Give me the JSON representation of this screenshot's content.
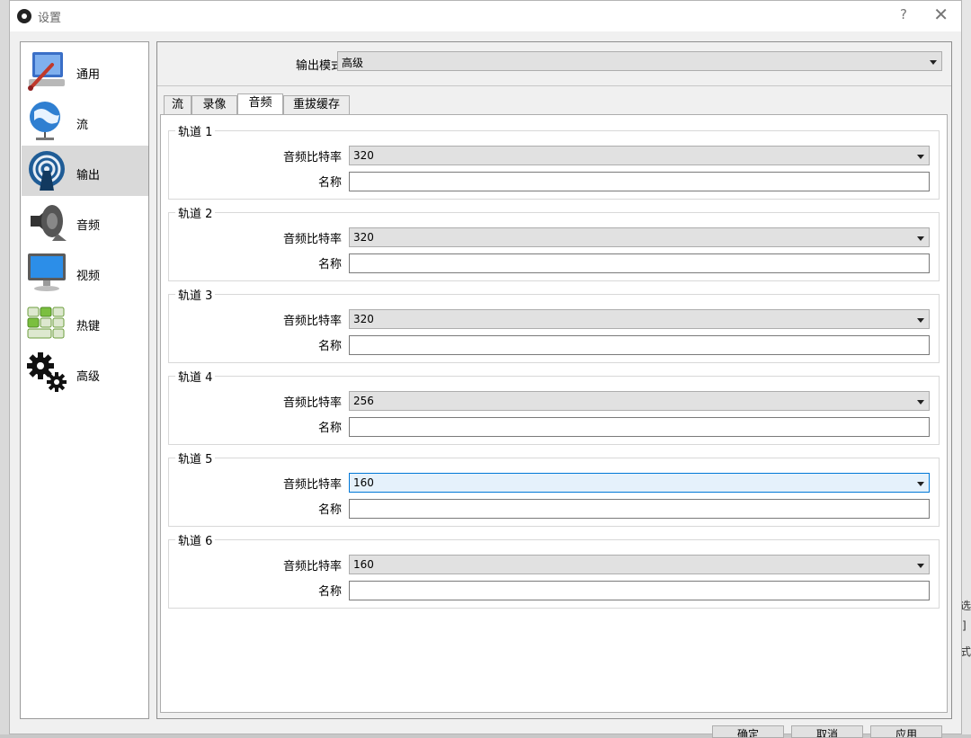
{
  "window": {
    "title": "设置"
  },
  "background": {
    "right_fragments": [
      "选",
      "]",
      "式"
    ]
  },
  "sidebar": {
    "items": [
      {
        "label": "通用",
        "icon": "general-settings-icon"
      },
      {
        "label": "流",
        "icon": "stream-globe-icon"
      },
      {
        "label": "输出",
        "icon": "output-broadcast-icon"
      },
      {
        "label": "音频",
        "icon": "audio-speaker-icon"
      },
      {
        "label": "视频",
        "icon": "video-monitor-icon"
      },
      {
        "label": "热键",
        "icon": "hotkeys-keyboard-icon"
      },
      {
        "label": "高级",
        "icon": "advanced-gears-icon"
      }
    ],
    "active_index": 2
  },
  "output": {
    "mode_label": "输出模式",
    "mode_value": "高级",
    "tabs": [
      "流",
      "录像",
      "音频",
      "重拔缓存"
    ],
    "active_tab": 2
  },
  "labels": {
    "bitrate": "音频比特率",
    "name": "名称"
  },
  "tracks": [
    {
      "title": "轨道 1",
      "bitrate": "320",
      "name": ""
    },
    {
      "title": "轨道 2",
      "bitrate": "320",
      "name": ""
    },
    {
      "title": "轨道 3",
      "bitrate": "320",
      "name": ""
    },
    {
      "title": "轨道 4",
      "bitrate": "256",
      "name": ""
    },
    {
      "title": "轨道 5",
      "bitrate": "160",
      "name": "",
      "focused": true
    },
    {
      "title": "轨道 6",
      "bitrate": "160",
      "name": ""
    }
  ],
  "buttons": {
    "ok": "确定",
    "cancel": "取消",
    "apply": "应用"
  },
  "colors": {
    "active_item": "#d9d9d9",
    "focus_border": "#0078d7",
    "focus_fill": "#e5f1fb"
  }
}
